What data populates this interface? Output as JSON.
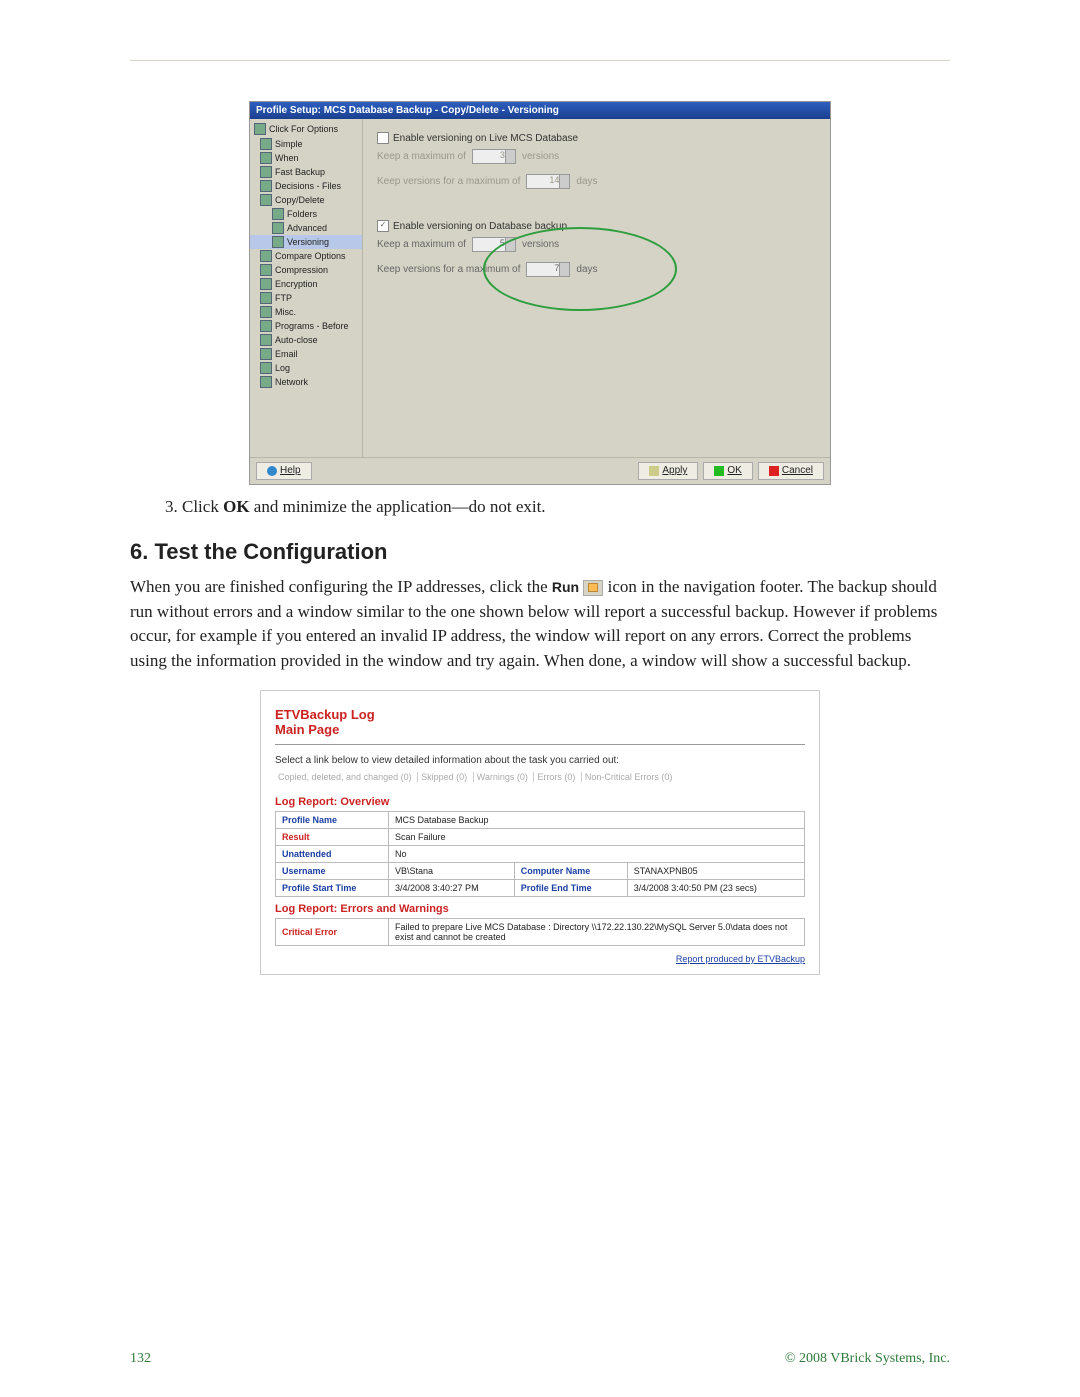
{
  "win1": {
    "title": "Profile Setup: MCS Database Backup - Copy/Delete - Versioning",
    "sidebar_head": "Click For Options",
    "sidebar": [
      "Simple",
      "When",
      "Fast Backup",
      "Decisions - Files",
      "Copy/Delete",
      "Folders",
      "Advanced",
      "Versioning",
      "Compare Options",
      "Compression",
      "Encryption",
      "FTP",
      "Misc.",
      "Programs - Before",
      "Auto-close",
      "Email",
      "Log",
      "Network"
    ],
    "cb1": "Enable versioning on Live MCS Database",
    "row1a": "Keep a maximum of",
    "row1a_val": "3",
    "row1a_unit": "versions",
    "row1b": "Keep versions for a maximum of",
    "row1b_val": "14",
    "row1b_unit": "days",
    "cb2": "Enable versioning on Database backup",
    "row2a": "Keep a maximum of",
    "row2a_val": "5",
    "row2a_unit": "versions",
    "row2b": "Keep versions for a maximum of",
    "row2b_val": "7",
    "row2b_unit": "days",
    "help": "Help",
    "apply": "Apply",
    "ok": "OK",
    "cancel": "Cancel"
  },
  "step_pre": "3.   Click ",
  "step_b": "OK",
  "step_post": " and minimize the application—do not exit.",
  "heading": "6. Test the Configuration",
  "para_a": "When you are finished configuring the IP addresses, click the ",
  "para_run": "Run",
  "para_b": " icon in the navigation footer. The backup should run without errors and a window similar to the one shown below will report a successful backup. However if problems occur, for example if you entered an invalid IP address, the window will report on any errors. Correct the problems using the information provided in the window and try again. When done, a window will show a successful backup.",
  "log": {
    "logo1": "ETVBackup Log",
    "logo2": "Main Page",
    "select_text": "Select a link below to view detailed information about the task you carried out:",
    "links": [
      "Copied, deleted, and changed (0)",
      "Skipped (0)",
      "Warnings (0)",
      "Errors (0)",
      "Non-Critical Errors (0)"
    ],
    "sec1": "Log Report: Overview",
    "rows1": [
      {
        "k": "Profile Name",
        "v": "MCS Database Backup"
      },
      {
        "k": "Result",
        "v": "Scan Failure",
        "red": true
      },
      {
        "k": "Unattended",
        "v": "No"
      }
    ],
    "rows2": [
      {
        "k1": "Username",
        "v1": "VB\\Stana",
        "k2": "Computer Name",
        "v2": "STANAXPNB05"
      },
      {
        "k1": "Profile Start Time",
        "v1": "3/4/2008 3:40:27 PM",
        "k2": "Profile End Time",
        "v2": "3/4/2008 3:40:50 PM (23 secs)"
      }
    ],
    "sec2": "Log Report: Errors and Warnings",
    "err_k": "Critical Error",
    "err_v": "Failed to prepare Live MCS Database : Directory \\\\172.22.130.22\\MySQL Server 5.0\\data does not exist and cannot be created",
    "foot": "Report produced by ETVBackup"
  },
  "footer": {
    "page": "132",
    "copy": "© 2008 VBrick Systems, Inc."
  }
}
